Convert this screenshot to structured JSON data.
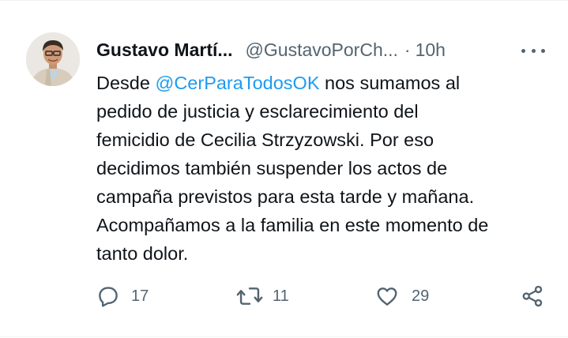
{
  "tweet": {
    "author_name": "Gustavo Martí...",
    "author_handle": "@GustavoPorCh...",
    "separator": "·",
    "time": "10h",
    "text_lines": [
      {
        "before": "Desde ",
        "mention": "@CerParaTodosOK",
        "after": " nos sumamos al"
      },
      "pedido de justicia y esclarecimiento del",
      "femicidio de Cecilia Strzyzowski. Por eso",
      "decidimos también suspender los actos de",
      "campaña previstos para esta tarde y mañana.",
      "Acompañamos a la familia en este momento de",
      "tanto dolor."
    ]
  },
  "actions": {
    "replies": "17",
    "retweets": "11",
    "likes": "29"
  },
  "colors": {
    "link": "#1d9bf0",
    "secondary_text": "#536471",
    "primary_text": "#0f1419",
    "divider": "#eff3f4"
  },
  "icons": [
    "more-icon",
    "reply-icon",
    "retweet-icon",
    "like-icon",
    "share-icon"
  ]
}
